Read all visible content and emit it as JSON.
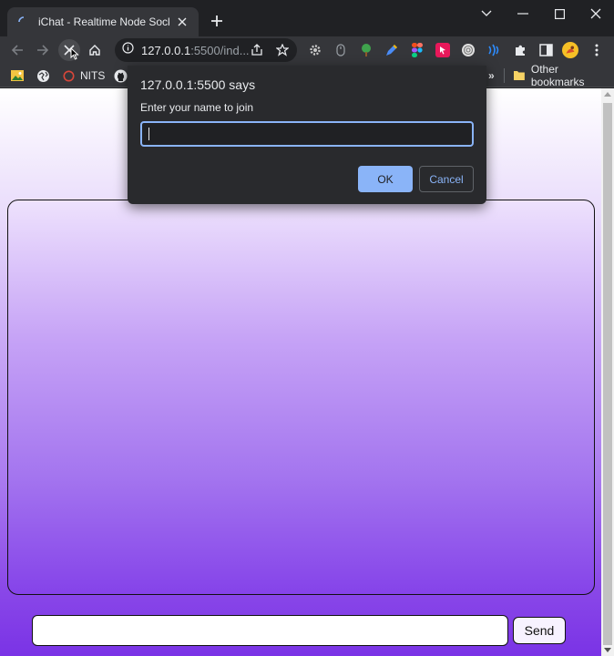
{
  "browser": {
    "tab": {
      "title": "iChat - Realtime Node Socket.io ("
    },
    "url": {
      "host": "127.0.0.1",
      "rest": ":5500/ind..."
    },
    "bookmarks": [
      {
        "label": "NITS"
      }
    ],
    "bookmarks_overflow": "»",
    "other_bookmarks": "Other bookmarks",
    "colors": {
      "frame": "#202124",
      "toolbar": "#35363a",
      "accent": "#8ab4f8"
    }
  },
  "dialog": {
    "title": "127.0.0.1:5500 says",
    "message": "Enter your name to join",
    "input_value": "",
    "ok_label": "OK",
    "cancel_label": "Cancel"
  },
  "page": {
    "message_input_value": "",
    "send_label": "Send",
    "colors": {
      "gradient_top": "#ffffff",
      "gradient_bottom": "#7a33e6"
    }
  }
}
